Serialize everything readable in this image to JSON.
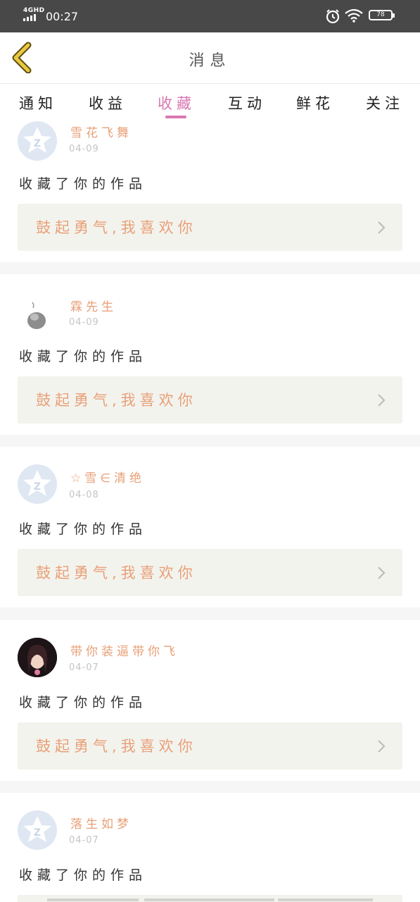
{
  "status_bar": {
    "network": "4GHD",
    "time": "00:27",
    "battery": "78"
  },
  "header": {
    "title": "消息"
  },
  "tabs": [
    {
      "label": "通知",
      "active": false
    },
    {
      "label": "收益",
      "active": false
    },
    {
      "label": "收藏",
      "active": true
    },
    {
      "label": "互动",
      "active": false
    },
    {
      "label": "鲜花",
      "active": false
    },
    {
      "label": "关注",
      "active": false
    }
  ],
  "notifications": [
    {
      "user": "雪花飞舞",
      "date": "04-09",
      "action": "收藏了你的作品",
      "work_title": "鼓起勇气,我喜欢你",
      "avatar": "default"
    },
    {
      "user": "霖先生",
      "date": "04-09",
      "action": "收藏了你的作品",
      "work_title": "鼓起勇气,我喜欢你",
      "avatar": "photo-sketch"
    },
    {
      "user": "☆雪∈清绝",
      "date": "04-08",
      "action": "收藏了你的作品",
      "work_title": "鼓起勇气,我喜欢你",
      "avatar": "default"
    },
    {
      "user": "带你装逼带你飞",
      "date": "04-07",
      "action": "收藏了你的作品",
      "work_title": "鼓起勇气,我喜欢你",
      "avatar": "photo-girl"
    },
    {
      "user": "落生如梦",
      "date": "04-07",
      "action": "收藏了你的作品",
      "work_title": "",
      "avatar": "default"
    }
  ],
  "colors": {
    "accent": "#d878b0",
    "username": "#e8a078",
    "status_bar": "#484848"
  }
}
